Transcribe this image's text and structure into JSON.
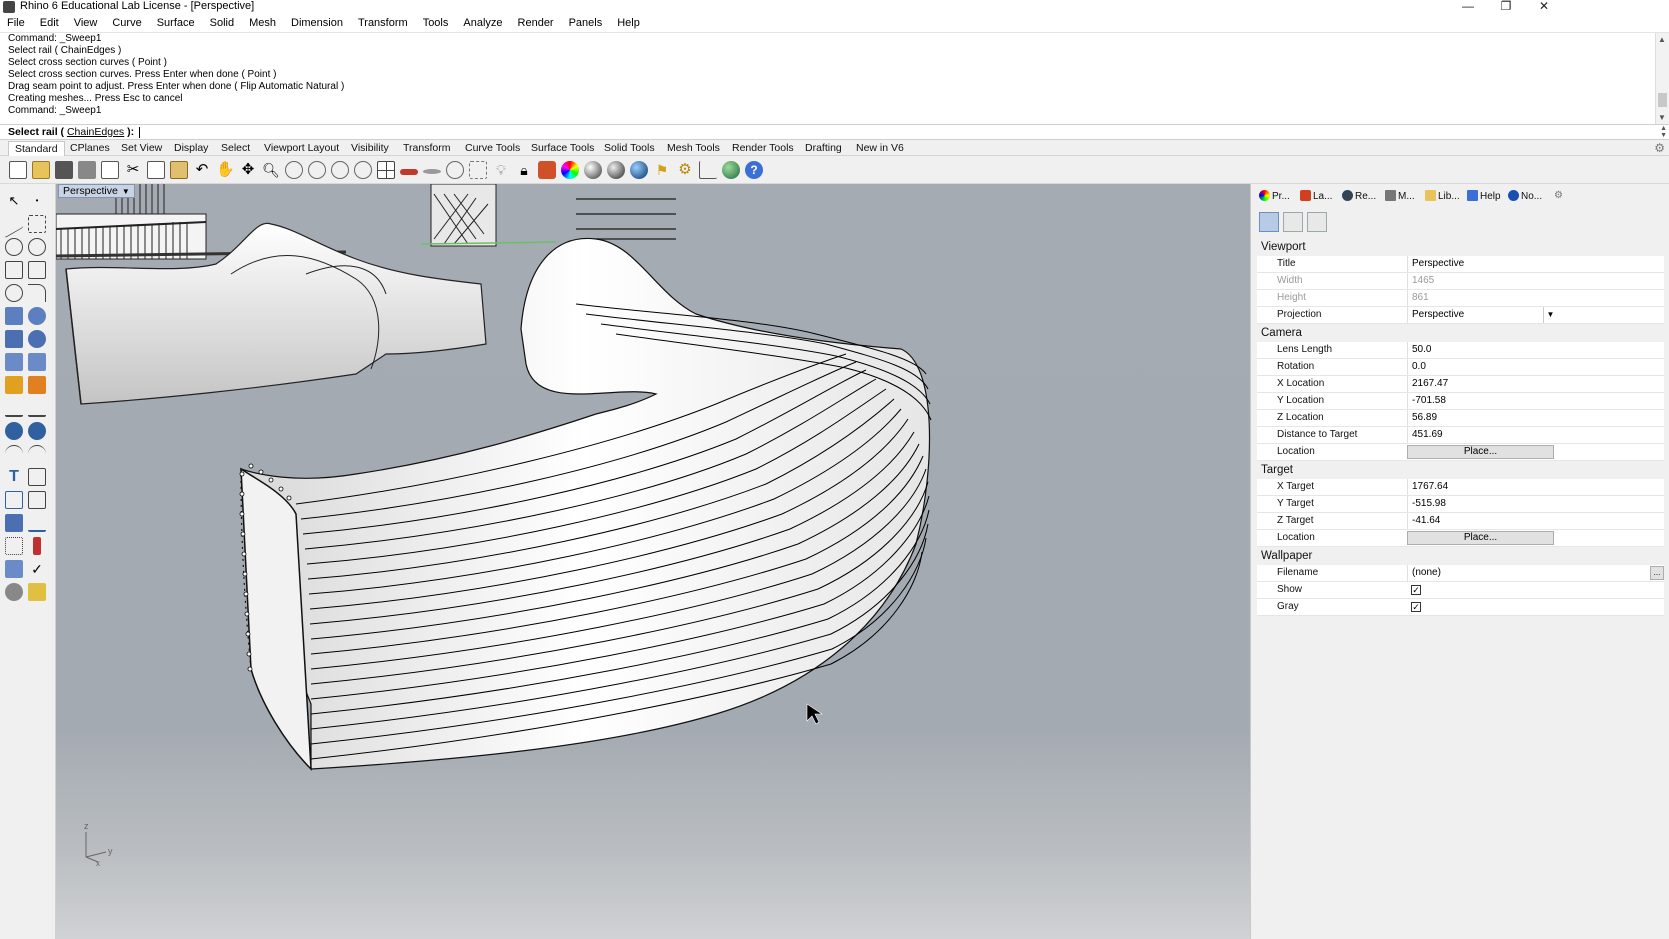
{
  "window": {
    "title": "Rhino 6 Educational Lab License - [Perspective]",
    "minimize": "—",
    "restore": "❐",
    "close": "✕"
  },
  "menu": [
    "File",
    "Edit",
    "View",
    "Curve",
    "Surface",
    "Solid",
    "Mesh",
    "Dimension",
    "Transform",
    "Tools",
    "Analyze",
    "Render",
    "Panels",
    "Help"
  ],
  "command_history": [
    "Command: _Sweep1",
    "Select rail ( ChainEdges )",
    "Select cross section curves ( Point )",
    "Select cross section curves. Press Enter when done ( Point )",
    "Drag seam point to adjust. Press Enter when done ( Flip  Automatic  Natural )",
    "Creating meshes... Press Esc to cancel",
    "Command: _Sweep1"
  ],
  "command_prompt": {
    "label": "Select rail (",
    "option": "ChainEdges",
    "suffix": "):"
  },
  "toolbar_tabs": [
    "Standard",
    "CPlanes",
    "Set View",
    "Display",
    "Select",
    "Viewport Layout",
    "Visibility",
    "Transform",
    "Curve Tools",
    "Surface Tools",
    "Solid Tools",
    "Mesh Tools",
    "Render Tools",
    "Drafting",
    "New in V6"
  ],
  "toolbar_icons": [
    "new-icon",
    "open-icon",
    "save-icon",
    "print-icon",
    "import-icon",
    "cut-icon",
    "copy-icon",
    "paste-icon",
    "undo-icon",
    "pan-icon",
    "move-view-icon",
    "zoom-icon",
    "zoom-window-icon",
    "zoom-extents-icon",
    "zoom-selected-icon",
    "rotate-view-icon",
    "four-viewports-icon",
    "car-icon",
    "ufo-icon",
    "dimmer-icon",
    "snap-icon",
    "light-icon",
    "lock-icon",
    "layer-icon",
    "color-wheel-icon",
    "sphere-shaded-icon",
    "sphere-rendered-icon",
    "sphere-blue-icon",
    "flag-icon",
    "gear-options-icon",
    "grid-icon",
    "globe-icon",
    "help-icon"
  ],
  "viewport": {
    "label": "Perspective",
    "axis_z": "z",
    "axis_y": "y",
    "axis_x": "x"
  },
  "panel_tabs": [
    "Pr...",
    "La...",
    "Re...",
    "M...",
    "Lib...",
    "Help",
    "No..."
  ],
  "properties": {
    "viewport_section": "Viewport",
    "title_label": "Title",
    "title_value": "Perspective",
    "width_label": "Width",
    "width_value": "1465",
    "height_label": "Height",
    "height_value": "861",
    "projection_label": "Projection",
    "projection_value": "Perspective",
    "camera_section": "Camera",
    "lens_label": "Lens Length",
    "lens_value": "50.0",
    "rotation_label": "Rotation",
    "rotation_value": "0.0",
    "xloc_label": "X Location",
    "xloc_value": "2167.47",
    "yloc_label": "Y Location",
    "yloc_value": "-701.58",
    "zloc_label": "Z Location",
    "zloc_value": "56.89",
    "dist_label": "Distance to Target",
    "dist_value": "451.69",
    "cam_location_label": "Location",
    "place_button": "Place...",
    "target_section": "Target",
    "xt_label": "X Target",
    "xt_value": "1767.64",
    "yt_label": "Y Target",
    "yt_value": "-515.98",
    "zt_label": "Z Target",
    "zt_value": "-41.64",
    "tgt_location_label": "Location",
    "wallpaper_section": "Wallpaper",
    "filename_label": "Filename",
    "filename_value": "(none)",
    "filename_button": "...",
    "show_label": "Show",
    "show_checked": true,
    "gray_label": "Gray",
    "gray_checked": true,
    "check_mark": "✓"
  }
}
